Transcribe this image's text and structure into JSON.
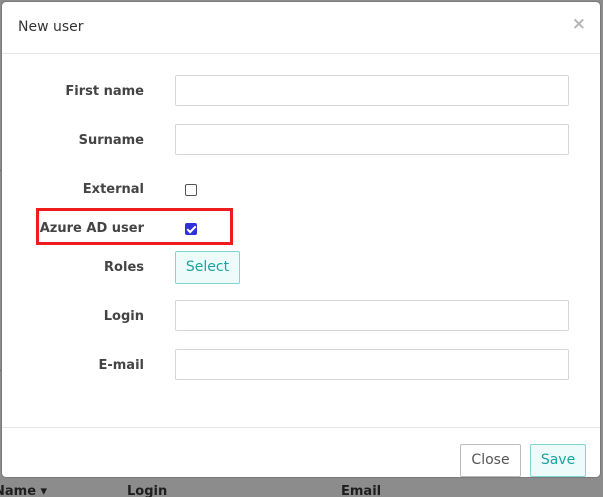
{
  "modal": {
    "title": "New user",
    "close_icon": "×"
  },
  "form": {
    "first_name": {
      "label": "First name",
      "value": ""
    },
    "surname": {
      "label": "Surname",
      "value": ""
    },
    "external": {
      "label": "External",
      "checked": false
    },
    "azure_ad_user": {
      "label": "Azure AD user",
      "checked": true
    },
    "roles": {
      "label": "Roles",
      "button_label": "Select"
    },
    "login": {
      "label": "Login",
      "value": ""
    },
    "email": {
      "label": "E-mail",
      "value": ""
    }
  },
  "footer": {
    "close_label": "Close",
    "save_label": "Save"
  },
  "background": {
    "columns": [
      "Name",
      "Login",
      "Email"
    ],
    "sort_icon": "▾"
  },
  "colors": {
    "accent": "#1aa3a0",
    "highlight": "#ee1c1c",
    "checkbox_checked": "#2f2fdc"
  }
}
